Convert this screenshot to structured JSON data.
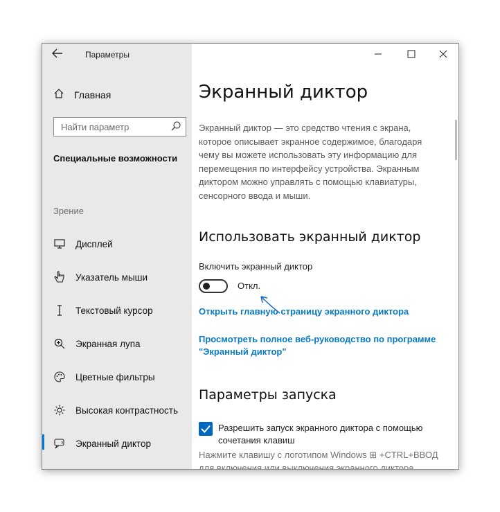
{
  "window": {
    "title": "Параметры",
    "back_icon": "back-arrow-icon",
    "minimize_icon": "minimize-icon",
    "maximize_icon": "maximize-icon",
    "close_icon": "close-icon"
  },
  "sidebar": {
    "home": {
      "label": "Главная",
      "icon": "home-icon"
    },
    "search": {
      "placeholder": "Найти параметр",
      "icon": "search-icon"
    },
    "section_title": "Специальные возможности",
    "group_title": "Зрение",
    "items": [
      {
        "label": "Дисплей",
        "icon": "monitor-icon"
      },
      {
        "label": "Указатель мыши",
        "icon": "mouse-pointer-icon"
      },
      {
        "label": "Текстовый курсор",
        "icon": "text-cursor-icon"
      },
      {
        "label": "Экранная лупа",
        "icon": "magnifier-icon"
      },
      {
        "label": "Цветные фильтры",
        "icon": "palette-icon"
      },
      {
        "label": "Высокая контрастность",
        "icon": "sun-icon"
      },
      {
        "label": "Экранный диктор",
        "icon": "narrator-icon",
        "active": true
      }
    ]
  },
  "main": {
    "title": "Экранный диктор",
    "description": "Экранный диктор — это средство чтения с экрана, которое описывает экранное содержимое, благодаря чему вы можете использовать эту информацию для перемещения по интерфейсу устройства. Экранным диктором можно управлять с помощью клавиатуры, сенсорного ввода и мыши.",
    "use_section": {
      "heading": "Использовать экранный диктор",
      "toggle_label": "Включить экранный диктор",
      "toggle_state": "Откл.",
      "toggle_on": false
    },
    "links": {
      "home_page": "Открыть главную страницу экранного диктора",
      "guide": "Просмотреть полное веб-руководство по программе \"Экранный диктор\""
    },
    "startup_section": {
      "heading": "Параметры запуска",
      "checkbox_label": "Разрешить запуск экранного диктора с помощью сочетания клавиш",
      "checkbox_checked": true,
      "hint": "Нажмите клавишу с логотипом Windows ⊞ +CTRL+ВВОД для включения или выключения экранного диктора"
    }
  },
  "colors": {
    "accent": "#0078d7",
    "link": "#0a7ac2",
    "sidebar_bg": "#e9e9e9",
    "annotation_arrow": "#1e6fc9"
  }
}
